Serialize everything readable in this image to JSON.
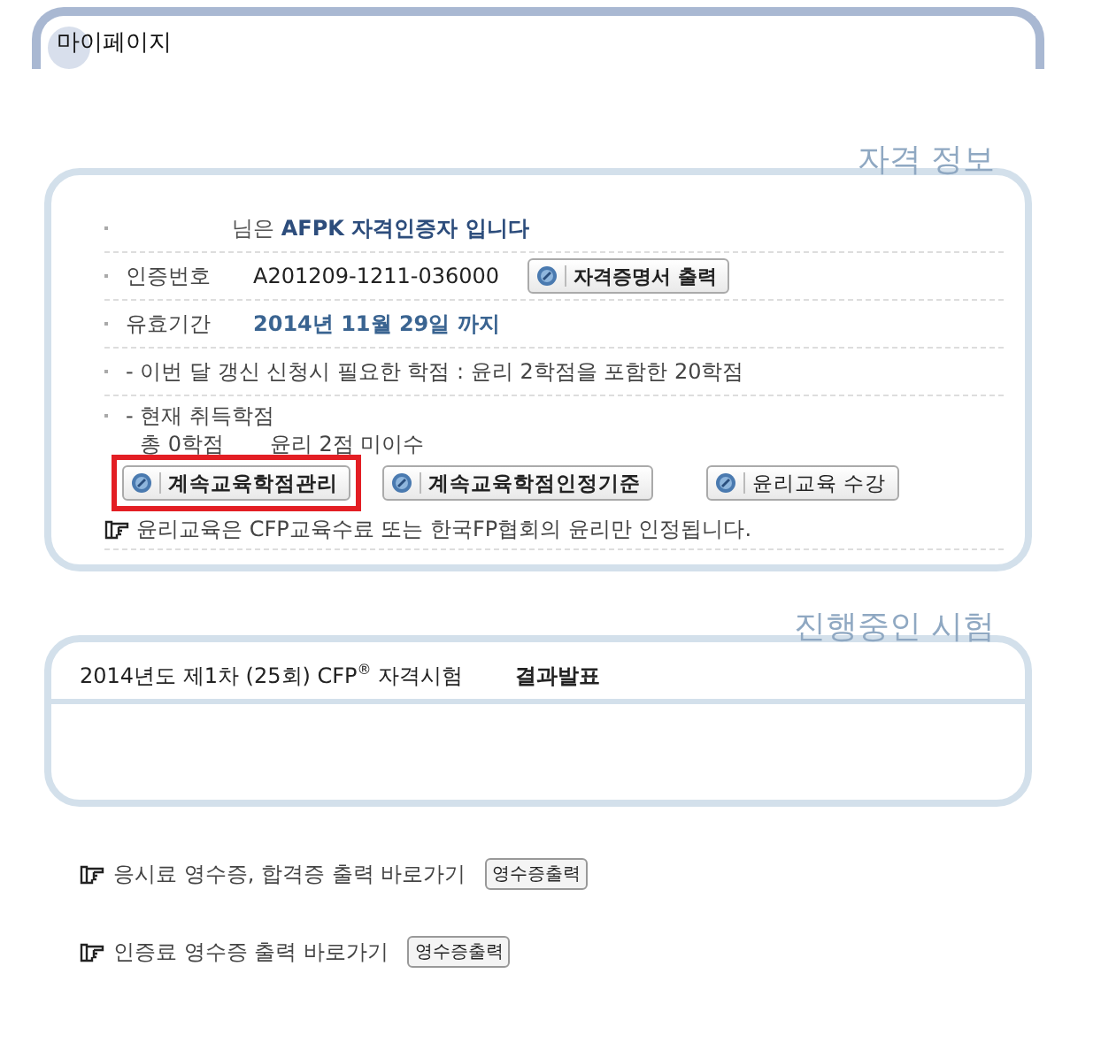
{
  "page": {
    "title": "마이페이지"
  },
  "certification": {
    "heading": "자격 정보",
    "greeting": "님은 **AFPK 자격인증자 입니다**",
    "rows": [
      {
        "label": "인증번호",
        "value": "A201209-1211-036000",
        "kind": "plain",
        "button": "자격증명서 출력"
      },
      {
        "label": "유효기간",
        "value": "2014년 11월 29일 까지",
        "kind": "highlight"
      }
    ],
    "requirement": "- 이번 달 갱신 신청시 필요한 학점 :   윤리 2학점을 포함한 20학점",
    "current_label": "- 현재 취득학점",
    "current_total": "총 0학점",
    "current_ethics": "윤리 2점 미이수",
    "buttons": [
      {
        "label": "계속교육학점관리",
        "bold": true,
        "highlighted": true
      },
      {
        "label": "계속교육학점인정기준",
        "bold": true,
        "highlighted": false
      },
      {
        "label": "윤리교육 수강",
        "bold": false,
        "highlighted": false
      }
    ],
    "note": "윤리교육은 CFP교육수료 또는 한국FP협회의 윤리만 인정됩니다."
  },
  "exams": {
    "heading": "진행중인 시험",
    "items": [
      {
        "name": "2014년도 제1차 (25회) CFP$^{®}$ 자격시험",
        "status": "결과발표"
      }
    ]
  },
  "links": [
    {
      "text": "응시료 영수증, 합격증 출력 바로가기",
      "button": "영수증출력"
    },
    {
      "text": "인증료 영수증 출력 바로가기",
      "button": "영수증출력"
    }
  ]
}
